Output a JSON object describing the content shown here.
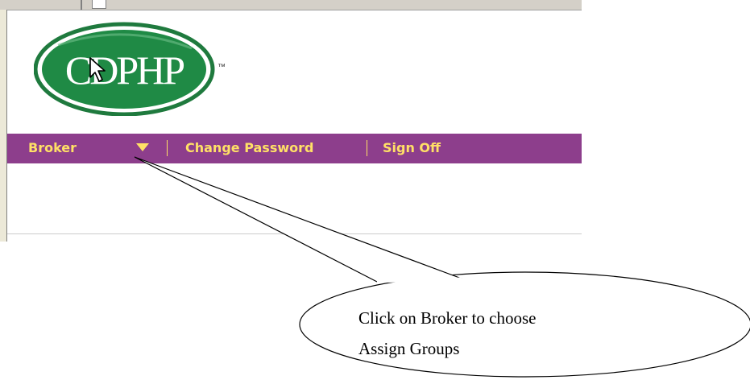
{
  "logo": {
    "text": "CDPHP",
    "trademark": "™",
    "ring_color": "#1f7a3e",
    "fill_color": "#1f8a45"
  },
  "navbar": {
    "background": "#8d3e8c",
    "text_color": "#ffe066",
    "broker_label": "Broker",
    "change_password_label": "Change Password",
    "sign_off_label": "Sign Off"
  },
  "callout": {
    "line1": "Click on Broker to choose",
    "line2": "Assign Groups"
  }
}
